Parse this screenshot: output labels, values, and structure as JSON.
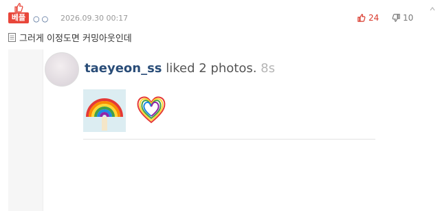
{
  "comment": {
    "badge_label": "베플",
    "nickname": "○○",
    "date": "2026.09.30 00:17",
    "upvotes": "24",
    "downvotes": "10",
    "text": "그러게 이정도면 커밍아웃인데"
  },
  "embed": {
    "username": "taeyeon_ss",
    "action": " liked 2 photos. ",
    "time": "8s",
    "photos": [
      "rainbow-balloon-photo",
      "rainbow-heart-photo"
    ]
  },
  "colors": {
    "badge": "#e8463a",
    "upvote": "#d9382b",
    "username": "#2a4d78"
  }
}
